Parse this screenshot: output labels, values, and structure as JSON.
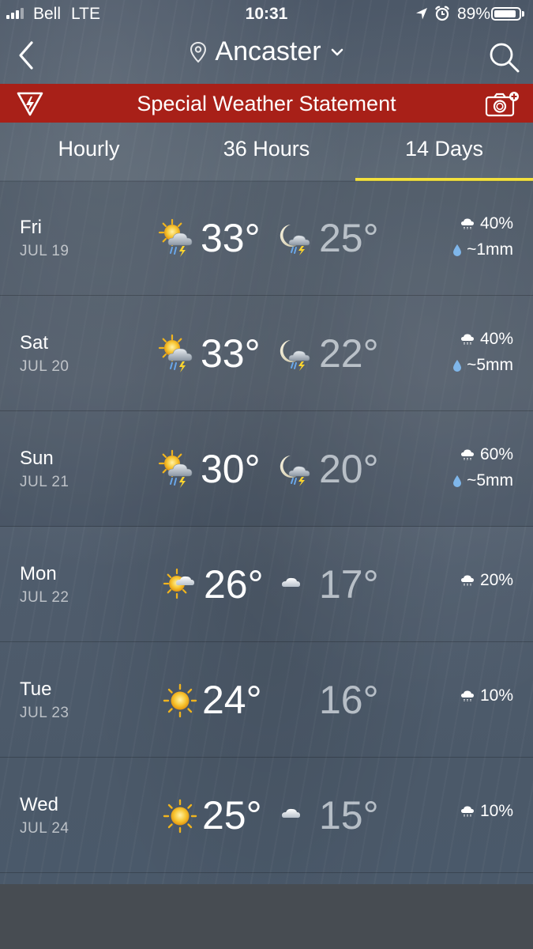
{
  "status_bar": {
    "carrier": "Bell",
    "network": "LTE",
    "time": "10:31",
    "battery_percent": "89%",
    "battery_level": 0.89
  },
  "header": {
    "location": "Ancaster",
    "icons": [
      "back-chevron-icon",
      "location-pin-icon",
      "chevron-down-icon",
      "search-icon"
    ]
  },
  "alert": {
    "text": "Special Weather Statement",
    "colors": {
      "background": "#a82018"
    }
  },
  "tabs": [
    {
      "label": "Hourly",
      "active": false
    },
    {
      "label": "36 Hours",
      "active": false
    },
    {
      "label": "14 Days",
      "active": true
    }
  ],
  "accent_color": "#f4e13c",
  "forecast": [
    {
      "day": "Fri",
      "date": "JUL 19",
      "day_icon": "sun-cloud-thunderstorm-icon",
      "high": "33°",
      "night_icon": "moon-cloud-thunderstorm-icon",
      "low": "25°",
      "pop": "40%",
      "precip": "~1mm"
    },
    {
      "day": "Sat",
      "date": "JUL 20",
      "day_icon": "sun-cloud-thunderstorm-icon",
      "high": "33°",
      "night_icon": "moon-cloud-thunderstorm-icon",
      "low": "22°",
      "pop": "40%",
      "precip": "~5mm"
    },
    {
      "day": "Sun",
      "date": "JUL 21",
      "day_icon": "sun-cloud-thunderstorm-icon",
      "high": "30°",
      "night_icon": "moon-cloud-thunderstorm-icon",
      "low": "20°",
      "pop": "60%",
      "precip": "~5mm"
    },
    {
      "day": "Mon",
      "date": "JUL 22",
      "day_icon": "sun-cloud-icon",
      "high": "26°",
      "night_icon": "moon-cloud-icon",
      "low": "17°",
      "pop": "20%",
      "precip": ""
    },
    {
      "day": "Tue",
      "date": "JUL 23",
      "day_icon": "sun-icon",
      "high": "24°",
      "night_icon": "moon-icon",
      "low": "16°",
      "pop": "10%",
      "precip": ""
    },
    {
      "day": "Wed",
      "date": "JUL 24",
      "day_icon": "sun-icon",
      "high": "25°",
      "night_icon": "moon-cloud-icon",
      "low": "15°",
      "pop": "10%",
      "precip": ""
    }
  ]
}
